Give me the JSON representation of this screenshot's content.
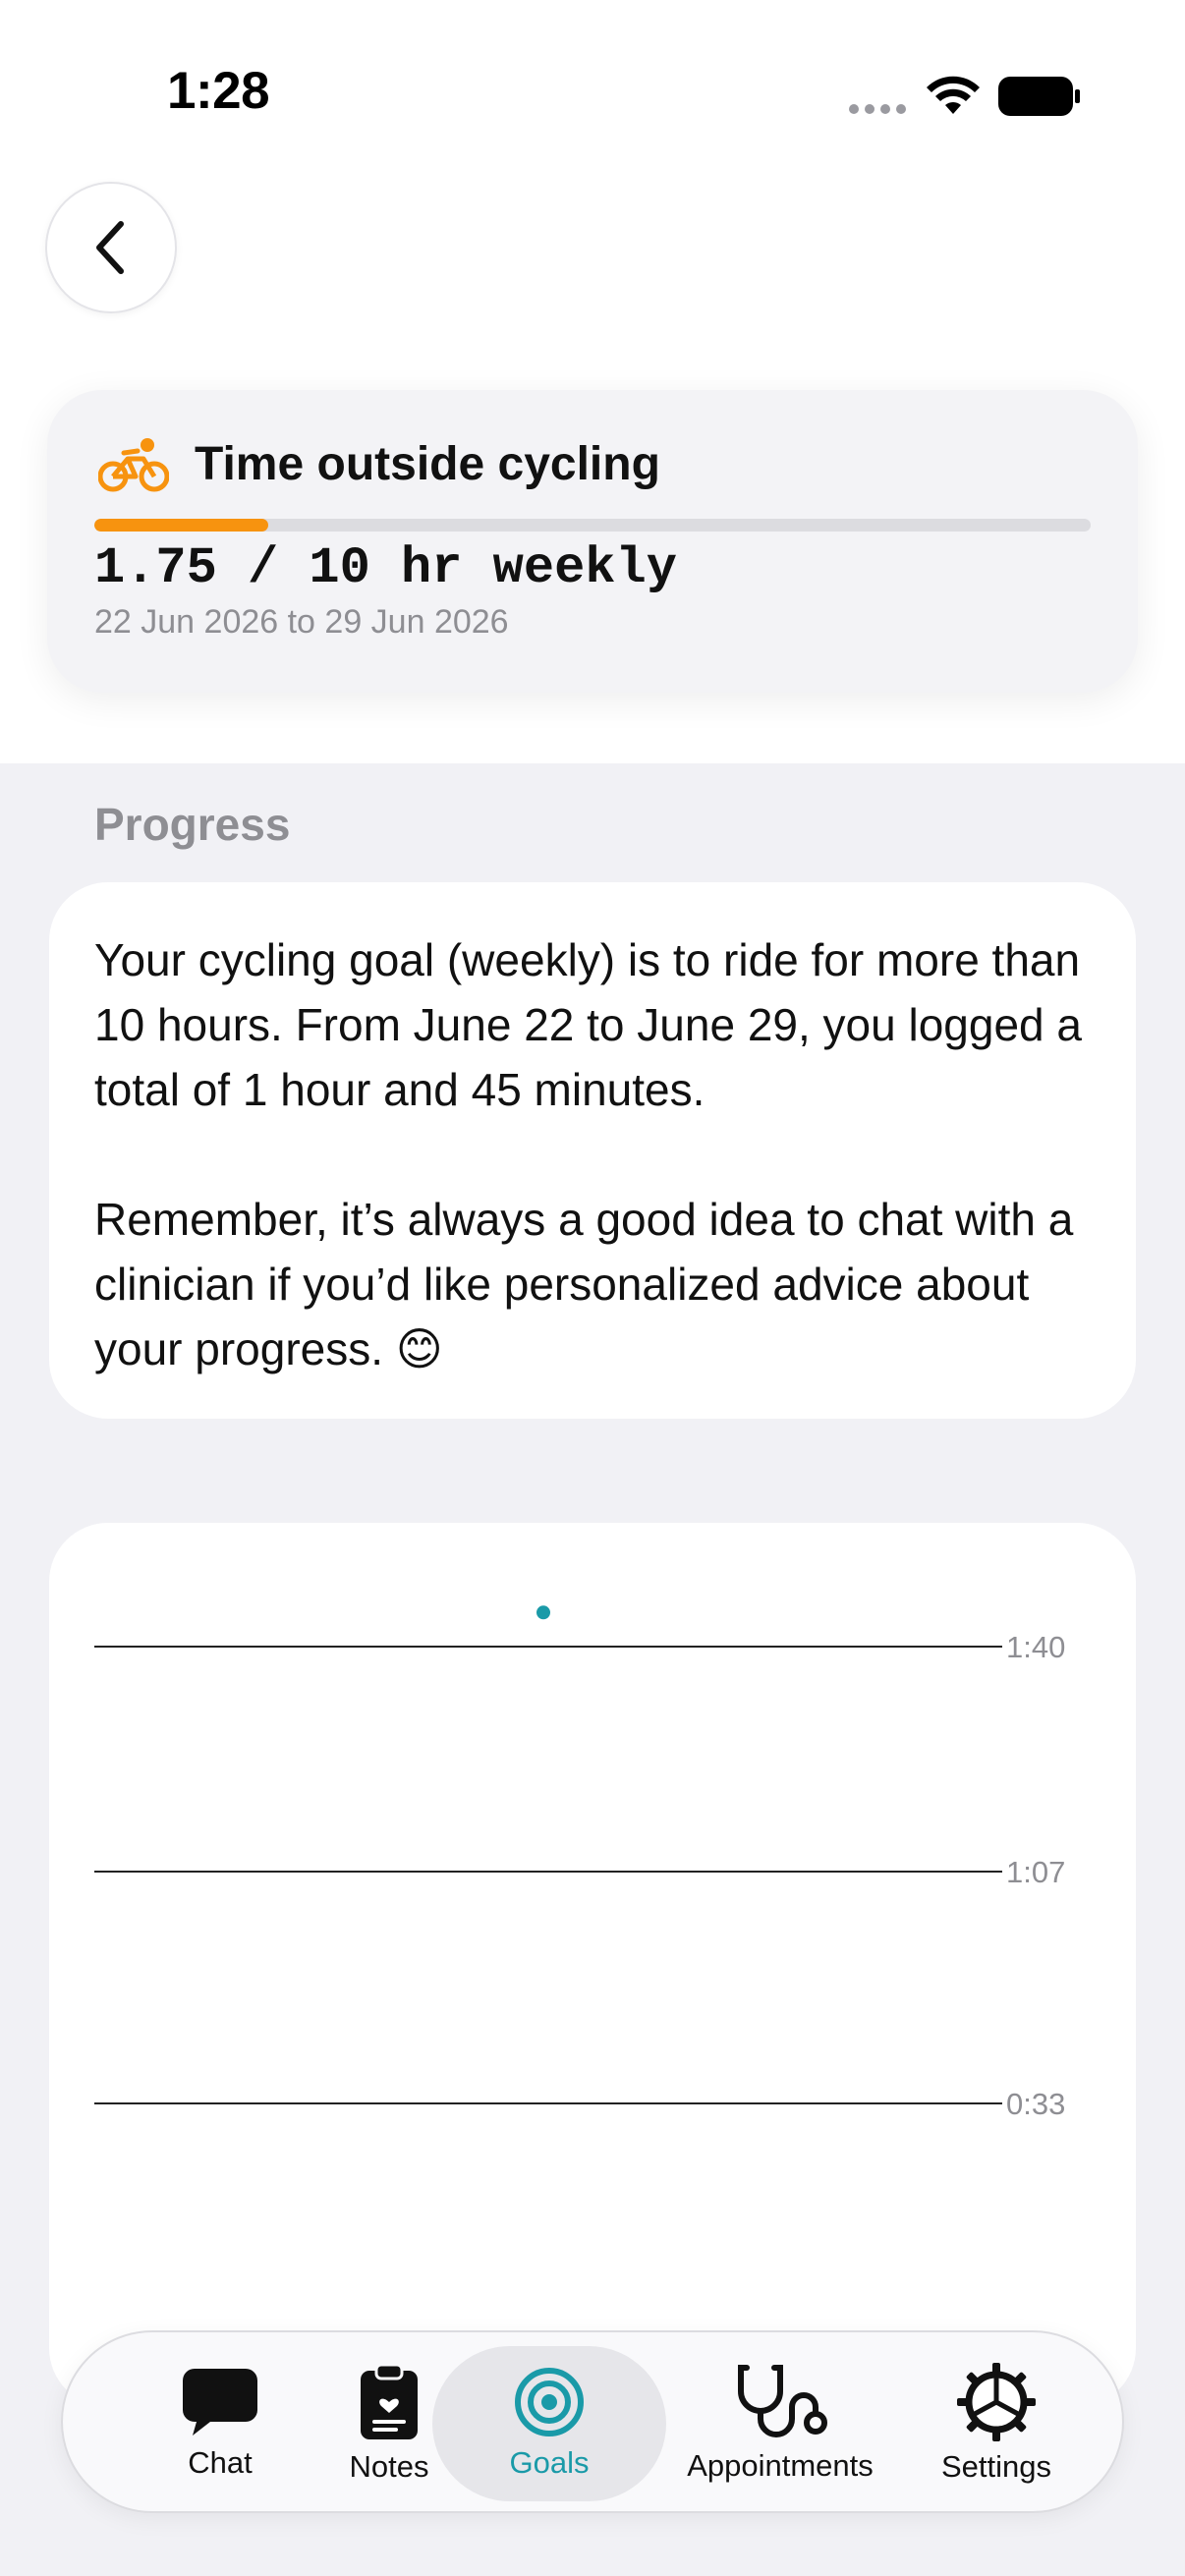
{
  "status_bar": {
    "time": "1:28"
  },
  "goal": {
    "title": "Time outside cycling",
    "progress_fraction": 0.175,
    "amount": "1.75 / 10 hr weekly",
    "dates": "22 Jun 2026 to 29 Jun 2026",
    "accent_color": "#f7930f"
  },
  "progress": {
    "section_title": "Progress",
    "message": "Your cycling goal (weekly) is to ride for more than 10 hours. From June 22 to June 29, you logged a total of 1 hour and 45 minutes.\n\nRemember, it’s always a good idea to chat with a clinician if you’d like personalized advice about your progress. 😊"
  },
  "chart_data": {
    "type": "scatter",
    "title": "",
    "xlabel": "",
    "ylabel": "",
    "y_ticks": [
      "1:40",
      "1:07",
      "0:33"
    ],
    "series": [
      {
        "values": [
          {
            "x": "22 Jun 2026",
            "y": "1:45"
          }
        ],
        "color": "#1a9aa8"
      }
    ],
    "grid": true
  },
  "tab_bar": {
    "active": "Goals",
    "active_color": "#1a9aa8",
    "items": [
      {
        "label": "Chat",
        "icon": "chat-bubble-icon"
      },
      {
        "label": "Notes",
        "icon": "clipboard-icon"
      },
      {
        "label": "Goals",
        "icon": "target-icon"
      },
      {
        "label": "Appointments",
        "icon": "stethoscope-icon"
      },
      {
        "label": "Settings",
        "icon": "gear-icon"
      }
    ]
  }
}
